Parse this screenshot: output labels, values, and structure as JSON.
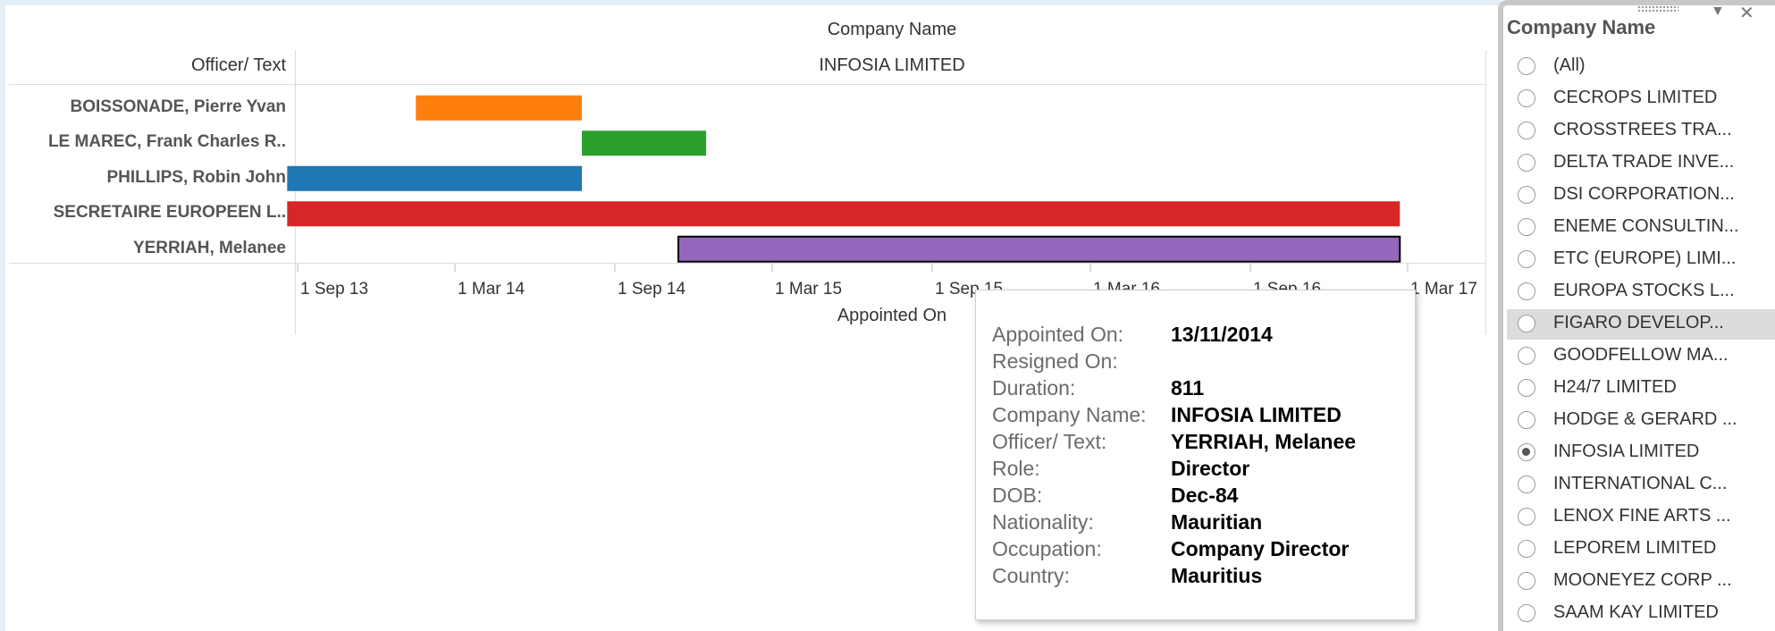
{
  "chart_data": {
    "type": "gantt",
    "column_header": "Company Name",
    "column_value": "INFOSIA LIMITED",
    "row_header": "Officer/ Text",
    "xlabel": "Appointed On",
    "x_ticks": [
      "1 Sep 13",
      "1 Mar 14",
      "1 Sep 14",
      "1 Mar 15",
      "1 Sep 15",
      "1 Mar 16",
      "1 Sep 16",
      "1 Mar 17"
    ],
    "x_tick_dates": [
      "2013-09-01",
      "2014-03-01",
      "2014-09-01",
      "2015-03-01",
      "2015-09-01",
      "2016-03-01",
      "2016-09-01",
      "2017-03-01"
    ],
    "series": [
      {
        "officer": "BOISSONADE, Pierre Yvan",
        "start": "2014-01-15",
        "end": "2014-07-25",
        "color": "#ff7f0e"
      },
      {
        "officer": "LE MAREC, Frank Charles R..",
        "start": "2014-07-25",
        "end": "2014-12-15",
        "color": "#2ca02c"
      },
      {
        "officer": "PHILLIPS, Robin John",
        "start": "2013-08-20",
        "end": "2014-07-25",
        "color": "#1f77b4"
      },
      {
        "officer": "SECRETAIRE EUROPEEN L..",
        "start": "2013-08-20",
        "end": "2017-02-20",
        "color": "#d62728"
      },
      {
        "officer": "YERRIAH, Melanee",
        "start": "2014-11-13",
        "end": "2017-02-20",
        "color": "#9467bd",
        "selected": true
      }
    ]
  },
  "tooltip": [
    {
      "key": "Appointed On:",
      "value": "13/11/2014"
    },
    {
      "key": "Resigned On:",
      "value": ""
    },
    {
      "key": "Duration:",
      "value": "811"
    },
    {
      "key": "Company Name:",
      "value": "INFOSIA LIMITED"
    },
    {
      "key": "Officer/ Text:",
      "value": "YERRIAH, Melanee"
    },
    {
      "key": "Role:",
      "value": "Director"
    },
    {
      "key": "DOB:",
      "value": "Dec-84"
    },
    {
      "key": "Nationality:",
      "value": "Mauritian"
    },
    {
      "key": "Occupation:",
      "value": "Company Director"
    },
    {
      "key": "Country:",
      "value": "Mauritius"
    }
  ],
  "filter": {
    "title": "Company Name",
    "icons": {
      "menu": "dropdown-arrow-icon",
      "close": "close-icon"
    },
    "options": [
      {
        "label": "(All)",
        "selected": false
      },
      {
        "label": "CECROPS LIMITED",
        "selected": false
      },
      {
        "label": "CROSSTREES TRA...",
        "selected": false
      },
      {
        "label": "DELTA TRADE INVE...",
        "selected": false
      },
      {
        "label": "DSI CORPORATION...",
        "selected": false
      },
      {
        "label": "ENEME CONSULTIN...",
        "selected": false
      },
      {
        "label": "ETC (EUROPE) LIMI...",
        "selected": false
      },
      {
        "label": "EUROPA STOCKS L...",
        "selected": false
      },
      {
        "label": "FIGARO DEVELOP...",
        "selected": false,
        "hover": true
      },
      {
        "label": "GOODFELLOW MA...",
        "selected": false
      },
      {
        "label": "H24/7 LIMITED",
        "selected": false
      },
      {
        "label": "HODGE & GERARD ...",
        "selected": false
      },
      {
        "label": "INFOSIA LIMITED",
        "selected": true
      },
      {
        "label": "INTERNATIONAL C...",
        "selected": false
      },
      {
        "label": "LENOX FINE ARTS ...",
        "selected": false
      },
      {
        "label": "LEPOREM LIMITED",
        "selected": false
      },
      {
        "label": "MOONEYEZ CORP ...",
        "selected": false
      },
      {
        "label": "SAAM KAY LIMITED",
        "selected": false
      }
    ]
  }
}
